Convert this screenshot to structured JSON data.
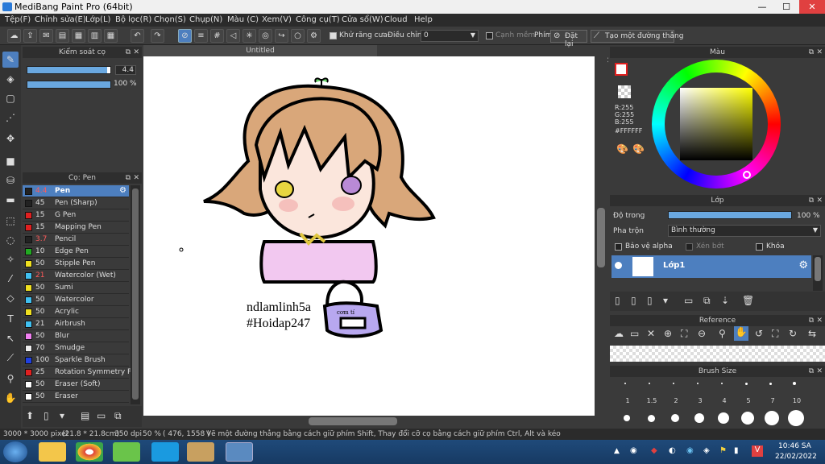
{
  "window": {
    "title": "MediBang Paint Pro (64bit)",
    "min": "—",
    "max": "☐",
    "close": "✕"
  },
  "menu": [
    "Tệp(F)",
    "Chỉnh sửa(E)",
    "Lớp(L)",
    "Bộ lọc(R)",
    "Chọn(S)",
    "Chụp(N)",
    "Màu (C)",
    "Xem(V)",
    "Công cụ(T)",
    "Cửa sổ(W)",
    "Cloud",
    "Help"
  ],
  "toolbar": {
    "antialias": "Khử răng cưa",
    "adjust_label": "Điều chỉnh",
    "adjust_value": "0",
    "edge": "Cạnh mềm",
    "pen_label": "Phím",
    "reset": "Đặt lại",
    "create_line": "Tạo một đường thẳng"
  },
  "brush_control": {
    "title": "Kiểm soát cọ",
    "size": "4.4",
    "opacity": "100 %",
    "size_fraction": 0.96,
    "opacity_fraction": 1.0
  },
  "brush_panel": {
    "title": "Cọ: Pen",
    "items": [
      {
        "size": "4.4",
        "name": "Pen",
        "color": "#222222",
        "selected": true,
        "red": true
      },
      {
        "size": "45",
        "name": "Pen (Sharp)",
        "color": "#222222"
      },
      {
        "size": "15",
        "name": "G Pen",
        "color": "#e02020"
      },
      {
        "size": "15",
        "name": "Mapping Pen",
        "color": "#e02020"
      },
      {
        "size": "3.7",
        "name": "Pencil",
        "color": "#222222",
        "red": true
      },
      {
        "size": "10",
        "name": "Edge Pen",
        "color": "#22aa22"
      },
      {
        "size": "50",
        "name": "Stipple Pen",
        "color": "#f0e020"
      },
      {
        "size": "21",
        "name": "Watercolor (Wet)",
        "color": "#40c0f0",
        "red": true
      },
      {
        "size": "50",
        "name": "Sumi",
        "color": "#f0e020"
      },
      {
        "size": "50",
        "name": "Watercolor",
        "color": "#40c0f0"
      },
      {
        "size": "50",
        "name": "Acrylic",
        "color": "#f0e020"
      },
      {
        "size": "21",
        "name": "Airbrush",
        "color": "#40c0f0"
      },
      {
        "size": "50",
        "name": "Blur",
        "color": "#f080f0"
      },
      {
        "size": "70",
        "name": "Smudge",
        "color": "#eeeeee"
      },
      {
        "size": "100",
        "name": "Sparkle Brush",
        "color": "#2040e0"
      },
      {
        "size": "25",
        "name": "Rotation Symmetry Pe",
        "color": "#e02020"
      },
      {
        "size": "50",
        "name": "Eraser (Soft)",
        "color": "#ffffff"
      },
      {
        "size": "50",
        "name": "Eraser",
        "color": "#ffffff"
      }
    ]
  },
  "document": {
    "tab": "Untitled",
    "text1": "ndlamlinh5a",
    "text2": "#Hoidap247",
    "bag_text": "cơm tí"
  },
  "color_panel": {
    "title": "Màu",
    "r": "R:255",
    "g": "G:255",
    "b": "B:255",
    "hex": "#FFFFFF"
  },
  "layer_panel": {
    "title": "Lớp",
    "opacity_label": "Độ trong",
    "opacity_value": "100 %",
    "blend_label": "Pha trộn",
    "blend_value": "Bình thường",
    "protect_alpha": "Bảo vệ alpha",
    "clipping": "Xén bớt",
    "lock": "Khóa",
    "layer_name": "Lớp1"
  },
  "reference_panel": {
    "title": "Reference"
  },
  "brush_size_panel": {
    "title": "Brush Size",
    "sizes": [
      "1",
      "1.5",
      "2",
      "3",
      "4",
      "5",
      "7",
      "10"
    ]
  },
  "status": {
    "dims": "3000 * 3000 pixel",
    "cm": "(21.8 * 21.8cm)",
    "dpi": "350 dpi",
    "zoom": "50 %",
    "coords": "( 476, 1558 )",
    "hint": "Vẽ một đường thẳng bằng cách giữ phím Shift, Thay đổi cỡ cọ bằng cách giữ phím Ctrl, Alt và kéo"
  },
  "taskbar": {
    "time": "10:46 SA",
    "date": "22/02/2022"
  }
}
